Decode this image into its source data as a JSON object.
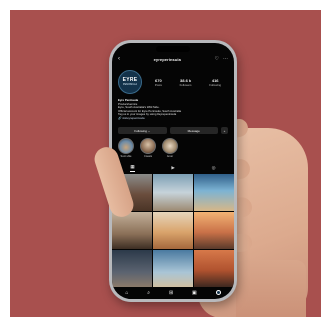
{
  "profile": {
    "username": "eyreperinsula",
    "avatar_logo_line1": "EYRE",
    "avatar_logo_line2": "PENINSULA",
    "stats": [
      {
        "value": "670",
        "label": "Posts"
      },
      {
        "value": "38.6 k",
        "label": "Followers"
      },
      {
        "value": "416",
        "label": "Following"
      }
    ],
    "bio_name": "Eyre Peninsula",
    "bio_lines": [
      "Product/service",
      "Eyre, South Australia's Wild Side.",
      "Official account for Eyre Peninsula, South Australia",
      "Tag us in your images by using #eyrepeninsula"
    ],
    "bio_link": "visiteyrepeninsula"
  },
  "actions": {
    "following_label": "Following ⌄",
    "message_label": "Message",
    "more_label": "+"
  },
  "highlights": [
    {
      "label": "Sunt uble"
    },
    {
      "label": "Coasts"
    },
    {
      "label": "Amer"
    }
  ],
  "icons": {
    "back": "back-arrow-icon",
    "bell": "bell-icon",
    "more": "more-icon",
    "grid": "grid-icon",
    "reels": "reels-icon",
    "tagged": "tagged-icon",
    "home": "home-icon",
    "search": "search-icon",
    "add": "add-icon",
    "shop": "shop-icon"
  },
  "colors": {
    "background": "#a8504e",
    "screen": "#050505"
  }
}
